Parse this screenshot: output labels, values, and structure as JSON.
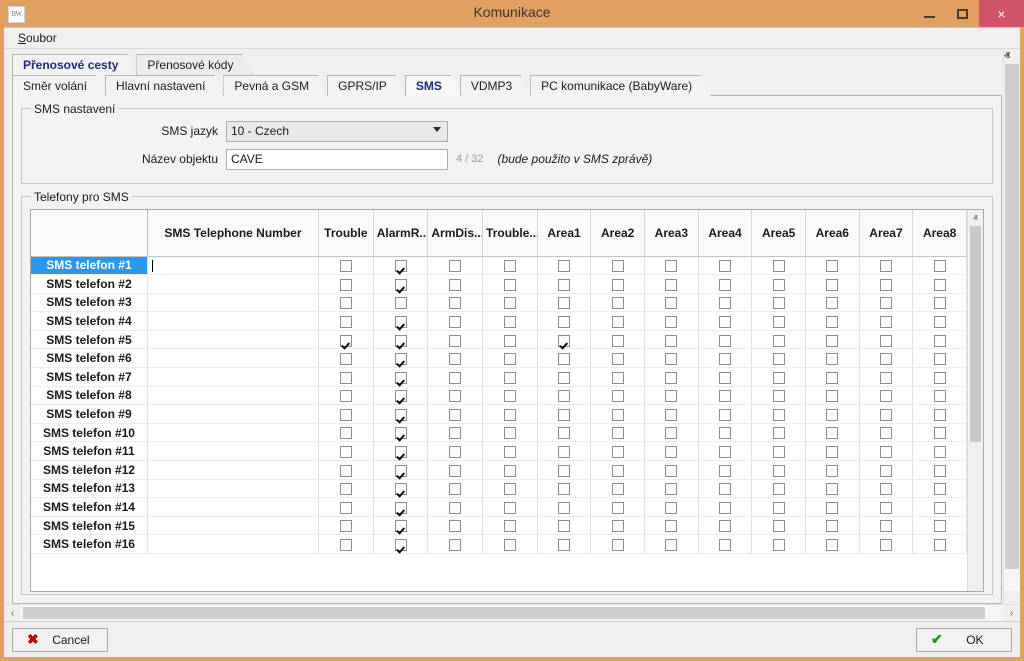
{
  "window": {
    "title": "Komunikace",
    "app_icon": "app-icon",
    "minimize_label": "–",
    "maximize_label": "□",
    "close_label": "×"
  },
  "menubar": {
    "items": [
      {
        "label": "Soubor",
        "mnemonic": "S",
        "rest": "oubor"
      }
    ]
  },
  "tabs_primary": [
    {
      "label": "Přenosové cesty",
      "active": true
    },
    {
      "label": "Přenosové kódy",
      "active": false
    }
  ],
  "tabs_secondary": [
    {
      "label": "Směr volání",
      "active": false
    },
    {
      "label": "Hlavní nastavení",
      "active": false
    },
    {
      "label": "Pevná a GSM",
      "active": false
    },
    {
      "label": "GPRS/IP",
      "active": false
    },
    {
      "label": "SMS",
      "active": true
    },
    {
      "label": "VDMP3",
      "active": false
    },
    {
      "label": "PC komunikace (BabyWare)",
      "active": false
    }
  ],
  "sms_settings": {
    "group_title": "SMS nastavení",
    "language_label": "SMS jazyk",
    "language_value": "10 - Czech",
    "language_options": [
      "10 - Czech"
    ],
    "object_name_label": "Název objektu",
    "object_name_value": "CAVE",
    "object_name_placeholder": "",
    "object_name_counter": "4 / 32",
    "object_name_hint": "(bude použito v SMS zprávě)"
  },
  "phones": {
    "group_title": "Telefony pro SMS",
    "columns": [
      "",
      "SMS Telephone Number",
      "Trouble",
      "AlarmR...",
      "ArmDis...",
      "Trouble...",
      "Area1",
      "Area2",
      "Area3",
      "Area4",
      "Area5",
      "Area6",
      "Area7",
      "Area8"
    ],
    "rows": [
      {
        "label": "SMS telefon #1",
        "number": "",
        "selected": true,
        "checks": [
          false,
          true,
          false,
          false,
          false,
          false,
          false,
          false,
          false,
          false,
          false,
          false
        ]
      },
      {
        "label": "SMS telefon #2",
        "number": "",
        "selected": false,
        "checks": [
          false,
          true,
          false,
          false,
          false,
          false,
          false,
          false,
          false,
          false,
          false,
          false
        ]
      },
      {
        "label": "SMS telefon #3",
        "number": "",
        "selected": false,
        "checks": [
          false,
          false,
          false,
          false,
          false,
          false,
          false,
          false,
          false,
          false,
          false,
          false
        ]
      },
      {
        "label": "SMS telefon #4",
        "number": "",
        "selected": false,
        "checks": [
          false,
          true,
          false,
          false,
          false,
          false,
          false,
          false,
          false,
          false,
          false,
          false
        ]
      },
      {
        "label": "SMS telefon #5",
        "number": "",
        "selected": false,
        "checks": [
          true,
          true,
          false,
          false,
          true,
          false,
          false,
          false,
          false,
          false,
          false,
          false
        ]
      },
      {
        "label": "SMS telefon #6",
        "number": "",
        "selected": false,
        "checks": [
          false,
          true,
          false,
          false,
          false,
          false,
          false,
          false,
          false,
          false,
          false,
          false
        ]
      },
      {
        "label": "SMS telefon #7",
        "number": "",
        "selected": false,
        "checks": [
          false,
          true,
          false,
          false,
          false,
          false,
          false,
          false,
          false,
          false,
          false,
          false
        ]
      },
      {
        "label": "SMS telefon #8",
        "number": "",
        "selected": false,
        "checks": [
          false,
          true,
          false,
          false,
          false,
          false,
          false,
          false,
          false,
          false,
          false,
          false
        ]
      },
      {
        "label": "SMS telefon #9",
        "number": "",
        "selected": false,
        "checks": [
          false,
          true,
          false,
          false,
          false,
          false,
          false,
          false,
          false,
          false,
          false,
          false
        ]
      },
      {
        "label": "SMS telefon #10",
        "number": "",
        "selected": false,
        "checks": [
          false,
          true,
          false,
          false,
          false,
          false,
          false,
          false,
          false,
          false,
          false,
          false
        ]
      },
      {
        "label": "SMS telefon #11",
        "number": "",
        "selected": false,
        "checks": [
          false,
          true,
          false,
          false,
          false,
          false,
          false,
          false,
          false,
          false,
          false,
          false
        ]
      },
      {
        "label": "SMS telefon #12",
        "number": "",
        "selected": false,
        "checks": [
          false,
          true,
          false,
          false,
          false,
          false,
          false,
          false,
          false,
          false,
          false,
          false
        ]
      },
      {
        "label": "SMS telefon #13",
        "number": "",
        "selected": false,
        "checks": [
          false,
          true,
          false,
          false,
          false,
          false,
          false,
          false,
          false,
          false,
          false,
          false
        ]
      },
      {
        "label": "SMS telefon #14",
        "number": "",
        "selected": false,
        "checks": [
          false,
          true,
          false,
          false,
          false,
          false,
          false,
          false,
          false,
          false,
          false,
          false
        ]
      },
      {
        "label": "SMS telefon #15",
        "number": "",
        "selected": false,
        "checks": [
          false,
          true,
          false,
          false,
          false,
          false,
          false,
          false,
          false,
          false,
          false,
          false
        ]
      },
      {
        "label": "SMS telefon #16",
        "number": "",
        "selected": false,
        "checks": [
          false,
          true,
          false,
          false,
          false,
          false,
          false,
          false,
          false,
          false,
          false,
          false
        ]
      }
    ]
  },
  "footer": {
    "cancel_label": "Cancel",
    "cancel_glyph": "✖",
    "ok_label": "OK",
    "ok_glyph": "✔"
  },
  "scrollbars": {
    "up_arrow": "ⱏ",
    "down_arrow": "ⱟ",
    "left_arrow": "‹",
    "right_arrow": "›"
  },
  "colors": {
    "titlebar": "#e0a061",
    "close_button": "#d2546a",
    "selection": "#2b97f0",
    "active_tab_text": "#1d2c78",
    "cancel_glyph": "#c00000",
    "ok_glyph": "#179a17"
  }
}
